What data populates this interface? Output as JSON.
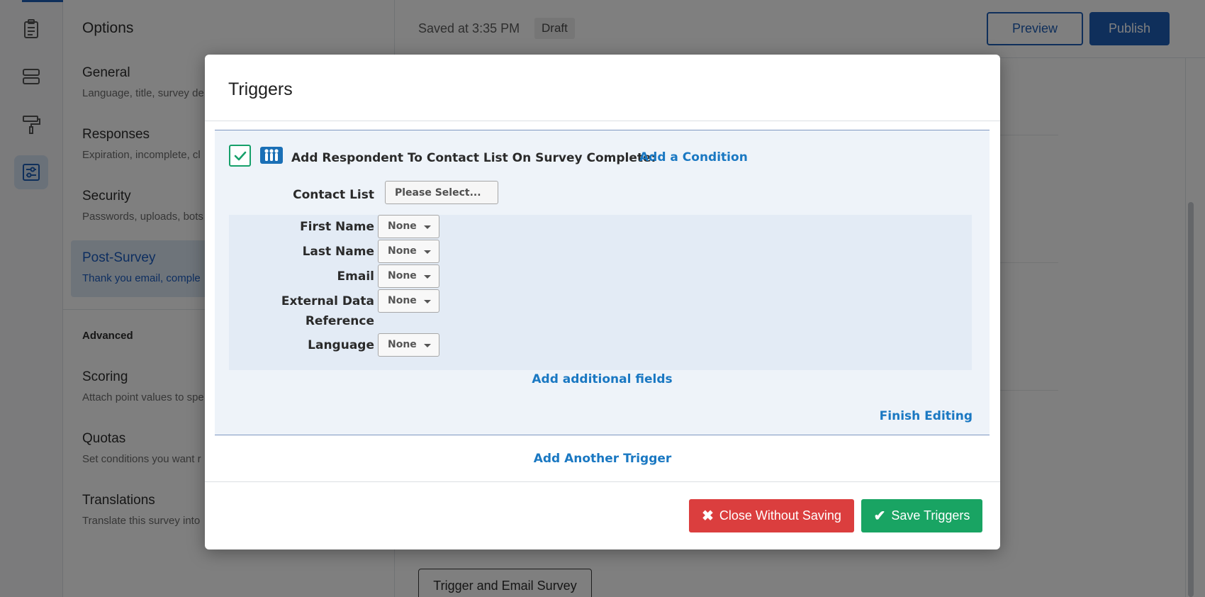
{
  "sidebar_rail": {
    "icons": [
      "survey-clipboard-icon",
      "blocks-layout-icon",
      "paint-roller-icon",
      "options-sliders-icon"
    ]
  },
  "options_panel": {
    "title": "Options",
    "items": [
      {
        "title": "General",
        "desc": "Language, title, survey de"
      },
      {
        "title": "Responses",
        "desc": "Expiration, incomplete, cl"
      },
      {
        "title": "Security",
        "desc": "Passwords, uploads, bots"
      },
      {
        "title": "Post-Survey",
        "desc": "Thank you email, comple"
      }
    ],
    "advanced_label": "Advanced",
    "advanced_items": [
      {
        "title": "Scoring",
        "desc": "Attach point values to spe"
      },
      {
        "title": "Quotas",
        "desc": "Set conditions you want r"
      },
      {
        "title": "Translations",
        "desc": "Translate this survey into"
      }
    ]
  },
  "header": {
    "saved_text": "Saved at 3:35 PM",
    "draft_badge": "Draft",
    "preview_label": "Preview",
    "publish_label": "Publish"
  },
  "main": {
    "trigger_email_label": "Trigger and Email Survey"
  },
  "modal": {
    "title": "Triggers",
    "trigger": {
      "checked": true,
      "title": "Add Respondent To Contact List On Survey Complete:",
      "add_condition": "Add a Condition",
      "contact_list_label": "Contact List",
      "contact_list_placeholder": "Please Select...",
      "fields": [
        {
          "label": "First Name",
          "value": "None"
        },
        {
          "label": "Last Name",
          "value": "None"
        },
        {
          "label": "Email",
          "value": "None"
        },
        {
          "label": "External Data",
          "label2": "Reference",
          "value": "None"
        },
        {
          "label": "Language",
          "value": "None"
        }
      ],
      "add_fields": "Add additional fields",
      "finish_editing": "Finish Editing"
    },
    "add_another_trigger": "Add Another Trigger",
    "close_label": "Close Without Saving",
    "save_label": "Save Triggers",
    "colors": {
      "close": "#db3e3e",
      "save": "#19a463",
      "link": "#1a78c2"
    }
  }
}
